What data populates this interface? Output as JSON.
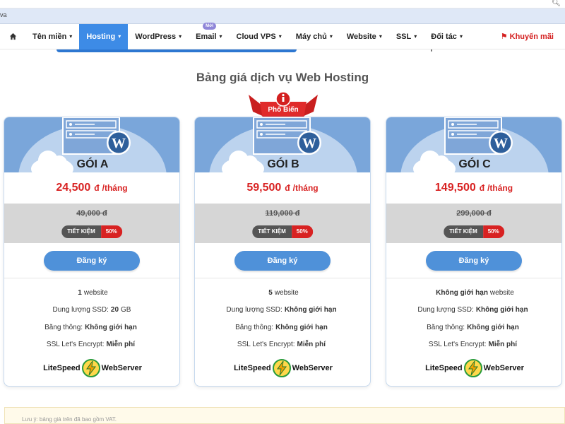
{
  "browser": {
    "url_fragment": "va",
    "zoom_icon": "zoom-icon"
  },
  "nav": {
    "home_icon": "home-icon",
    "items": [
      {
        "label": "Tên miền",
        "active": false
      },
      {
        "label": "Hosting",
        "active": true
      },
      {
        "label": "WordPress",
        "active": false
      },
      {
        "label": "Email",
        "active": false,
        "badge": "Mới"
      },
      {
        "label": "Cloud VPS",
        "active": false
      },
      {
        "label": "Máy chủ",
        "active": false
      },
      {
        "label": "Website",
        "active": false
      },
      {
        "label": "SSL",
        "active": false
      },
      {
        "label": "Đối tác",
        "active": false
      }
    ],
    "promo": "Khuyến mãi",
    "promo_icon": "flag-icon",
    "accent": "#3d8be6",
    "promo_color": "#d42020"
  },
  "page": {
    "title": "Bảng giá dịch vụ Web Hosting",
    "popular_label": "Phổ Biến",
    "note": "Lưu ý: bảng giá trên đã bao gồm VAT."
  },
  "plans": [
    {
      "name": "GÓI A",
      "price": "24,500",
      "currency": "đ",
      "unit": "/tháng",
      "old_price": "49,000 đ",
      "save_label": "TIẾT KIỆM",
      "save_pct": "50%",
      "button": "Đăng ký",
      "f1_value": "1",
      "f1_label": "website",
      "f2_label": "Dung lượng SSD:",
      "f2_value": "20",
      "f2_unit": "GB",
      "f3_label": "Băng thông:",
      "f3_value": "Không giới hạn",
      "f4_label": "SSL Let's Encrypt:",
      "f4_value": "Miễn phí",
      "ls_left": "LiteSpeed",
      "ls_right": "WebServer"
    },
    {
      "name": "GÓI B",
      "price": "59,500",
      "currency": "đ",
      "unit": "/tháng",
      "old_price": "119,000 đ",
      "save_label": "TIẾT KIỆM",
      "save_pct": "50%",
      "button": "Đăng ký",
      "f1_value": "5",
      "f1_label": "website",
      "f2_label": "Dung lượng SSD:",
      "f2_value": "Không giới hạn",
      "f2_unit": "",
      "f3_label": "Băng thông:",
      "f3_value": "Không giới hạn",
      "f4_label": "SSL Let's Encrypt:",
      "f4_value": "Miễn phí",
      "ls_left": "LiteSpeed",
      "ls_right": "WebServer"
    },
    {
      "name": "GÓI C",
      "price": "149,500",
      "currency": "đ",
      "unit": "/tháng",
      "old_price": "299,000 đ",
      "save_label": "TIẾT KIỆM",
      "save_pct": "50%",
      "button": "Đăng ký",
      "f1_value": "Không giới hạn",
      "f1_label": "website",
      "f2_label": "Dung lượng SSD:",
      "f2_value": "Không giới hạn",
      "f2_unit": "",
      "f3_label": "Băng thông:",
      "f3_value": "Không giới hạn",
      "f4_label": "SSL Let's Encrypt:",
      "f4_value": "Miễn phí",
      "ls_left": "LiteSpeed",
      "ls_right": "WebServer"
    }
  ],
  "colors": {
    "price_red": "#d82222",
    "button_blue": "#4f91d9",
    "hero_blue": "#7aa6da",
    "discount_gray": "#d6d6d6"
  }
}
